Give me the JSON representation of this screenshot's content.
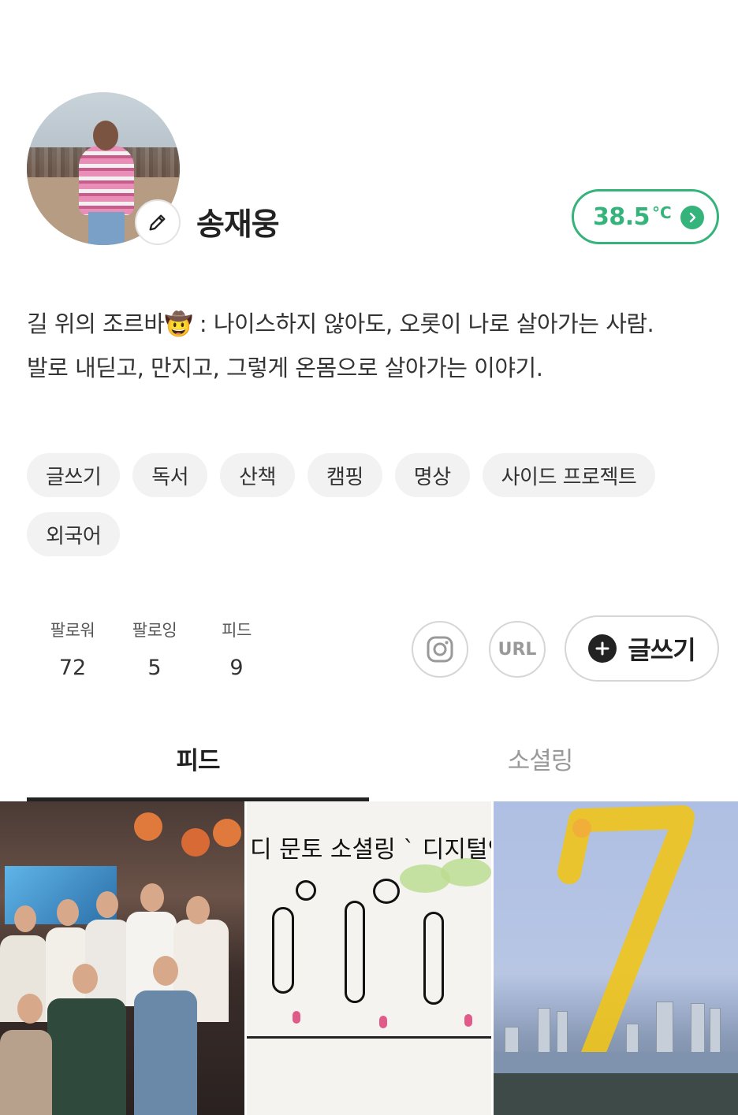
{
  "profile": {
    "name": "송재웅",
    "temperature_value": "38.5",
    "temperature_unit": "°C"
  },
  "bio": {
    "line1": "길 위의 조르바🤠 : 나이스하지 않아도, 오롯이 나로 살아가는 사람.",
    "line2": "발로 내딛고, 만지고, 그렇게 온몸으로  살아가는 이야기."
  },
  "tags": [
    "글쓰기",
    "독서",
    "산책",
    "캠핑",
    "명상",
    "사이드 프로젝트",
    "외국어"
  ],
  "stats": [
    {
      "label": "팔로워",
      "value": "72"
    },
    {
      "label": "팔로잉",
      "value": "5"
    },
    {
      "label": "피드",
      "value": "9"
    }
  ],
  "actions": {
    "url_label": "URL",
    "write_label": "글쓰기"
  },
  "tabs": [
    {
      "label": "피드",
      "active": true
    },
    {
      "label": "소셜링",
      "active": false
    }
  ],
  "feed_drawing_text": "디 문토 소셜링 ` 디지털인",
  "colors": {
    "accent_green": "#34b37a",
    "tag_bg": "#f2f2f2",
    "text": "#222222"
  },
  "icons": [
    "edit-pencil-icon",
    "chevron-right-icon",
    "instagram-icon",
    "plus-icon"
  ]
}
